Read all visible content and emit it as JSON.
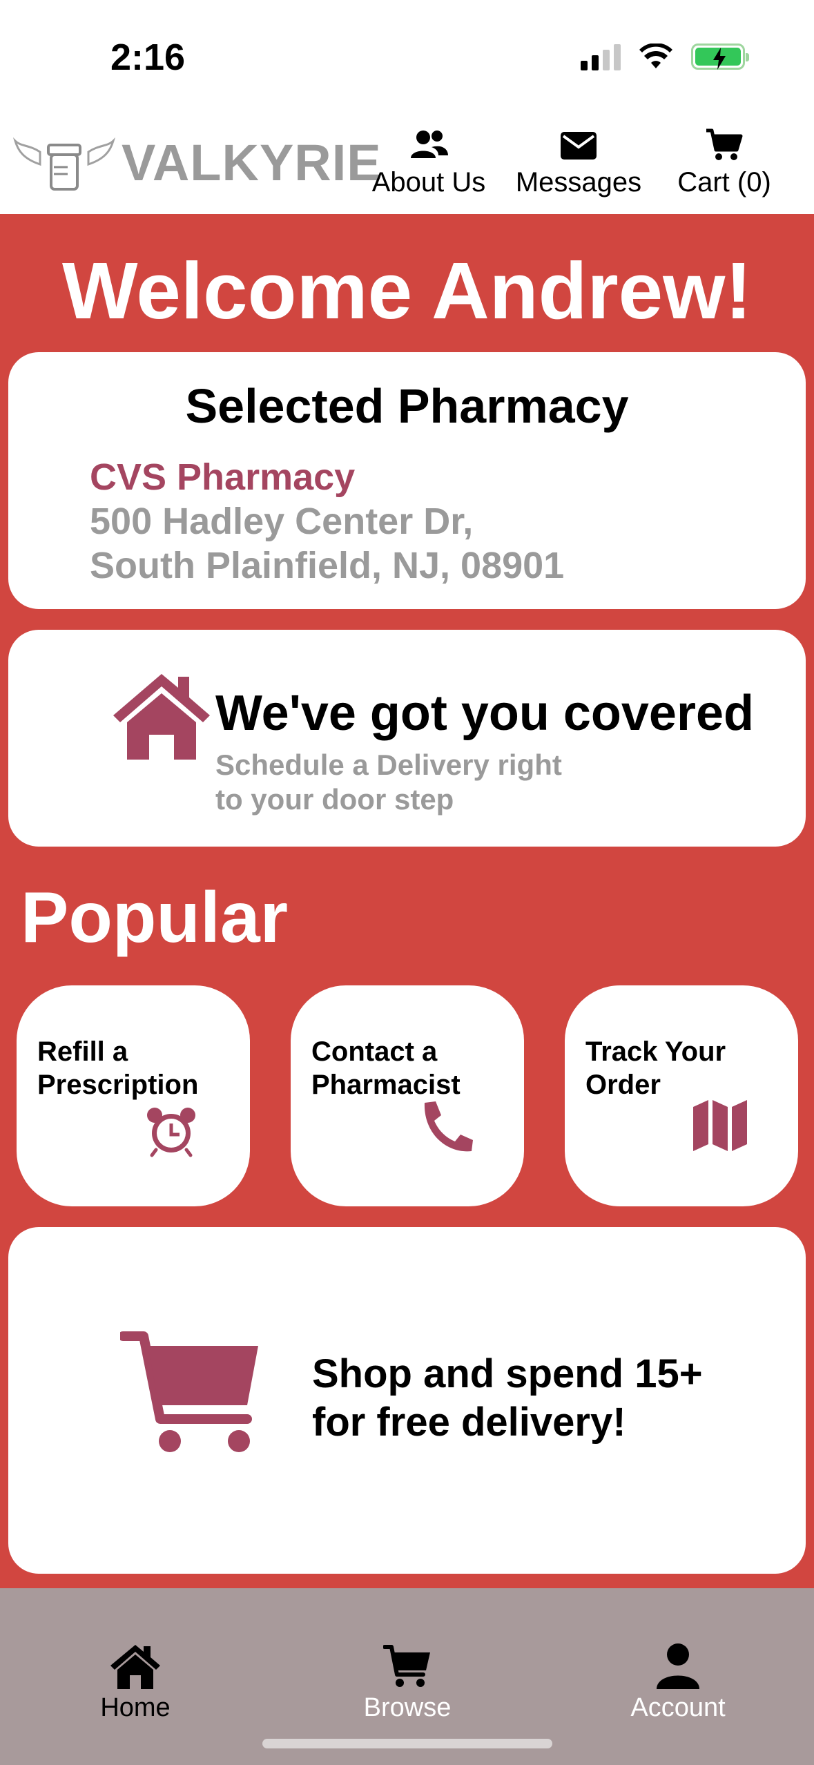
{
  "status_bar": {
    "time": "2:16"
  },
  "header": {
    "brand": "VALKYRIE",
    "nav": [
      {
        "label": "About Us",
        "icon": "users-icon"
      },
      {
        "label": "Messages",
        "icon": "envelope-icon"
      },
      {
        "label": "Cart (0)",
        "icon": "cart-icon"
      }
    ]
  },
  "main": {
    "welcome": "Welcome Andrew!",
    "pharmacy": {
      "title": "Selected Pharmacy",
      "name": "CVS Pharmacy",
      "address_line1": "500 Hadley Center Dr,",
      "address_line2": "South Plainfield, NJ, 08901"
    },
    "delivery": {
      "title": "We've got you covered",
      "subtitle_line1": "Schedule a Delivery right",
      "subtitle_line2": "to your door step"
    },
    "popular": {
      "title": "Popular",
      "tiles": [
        {
          "line1": "Refill a",
          "line2": "Prescription",
          "icon": "alarm-clock-icon"
        },
        {
          "line1": "Contact a",
          "line2": "Pharmacist",
          "icon": "phone-icon"
        },
        {
          "line1": "Track Your",
          "line2": "Order",
          "icon": "map-icon"
        }
      ]
    },
    "promo": {
      "line1": "Shop and spend 15+",
      "line2": "for free delivery!"
    }
  },
  "tabbar": {
    "tabs": [
      {
        "label": "Home",
        "icon": "home-icon",
        "active": true
      },
      {
        "label": "Browse",
        "icon": "cart-icon",
        "active": false
      },
      {
        "label": "Account",
        "icon": "user-icon",
        "active": false
      }
    ]
  },
  "colors": {
    "accent_red": "#d14640",
    "brand_maroon": "#a44560",
    "muted_gray": "#9a9a9a",
    "tabbar": "#a89a9b"
  }
}
